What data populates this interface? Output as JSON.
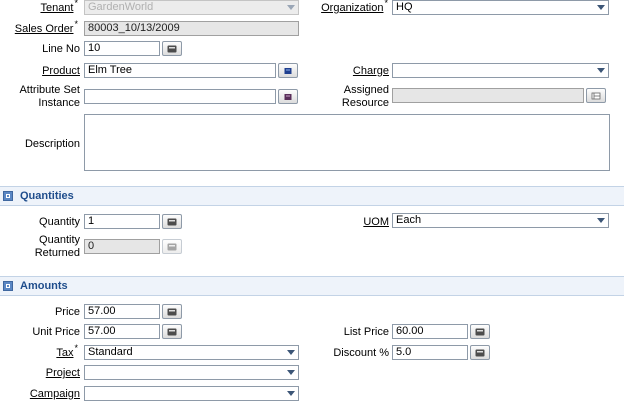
{
  "fields": {
    "tenant": {
      "label": "Tenant",
      "value": "GardenWorld"
    },
    "organization": {
      "label": "Organization",
      "value": "HQ"
    },
    "sales_order": {
      "label": "Sales Order",
      "value": "80003_10/13/2009"
    },
    "line_no": {
      "label": "Line No",
      "value": "10"
    },
    "product": {
      "label": "Product",
      "value": "Elm Tree"
    },
    "charge": {
      "label": "Charge",
      "value": ""
    },
    "attribute_set_instance": {
      "label_line1": "Attribute Set",
      "label_line2": "Instance",
      "value": ""
    },
    "assigned_resource": {
      "label_line1": "Assigned",
      "label_line2": "Resource",
      "value": ""
    },
    "description": {
      "label": "Description",
      "value": ""
    }
  },
  "quantities": {
    "title": "Quantities",
    "quantity": {
      "label": "Quantity",
      "value": "1"
    },
    "uom": {
      "label": "UOM",
      "value": "Each"
    },
    "quantity_returned": {
      "label_line1": "Quantity",
      "label_line2": "Returned",
      "value": "0"
    }
  },
  "amounts": {
    "title": "Amounts",
    "price": {
      "label": "Price",
      "value": "57.00"
    },
    "unit_price": {
      "label": "Unit Price",
      "value": "57.00"
    },
    "list_price": {
      "label": "List Price",
      "value": "60.00"
    },
    "tax": {
      "label": "Tax",
      "value": "Standard"
    },
    "discount": {
      "label": "Discount %",
      "value": "5.0"
    },
    "project": {
      "label": "Project",
      "value": ""
    },
    "campaign": {
      "label": "Campaign",
      "value": ""
    }
  },
  "colors": {
    "section_title": "#1f4d8c",
    "section_bg": "#eef3fa",
    "field_border": "#8e9aa8"
  },
  "icons": {
    "dropdown": "chevron-down-icon",
    "calculator": "calculator-icon",
    "search": "search-record-icon",
    "resource": "resource-assign-icon",
    "section": "collapse-icon"
  }
}
